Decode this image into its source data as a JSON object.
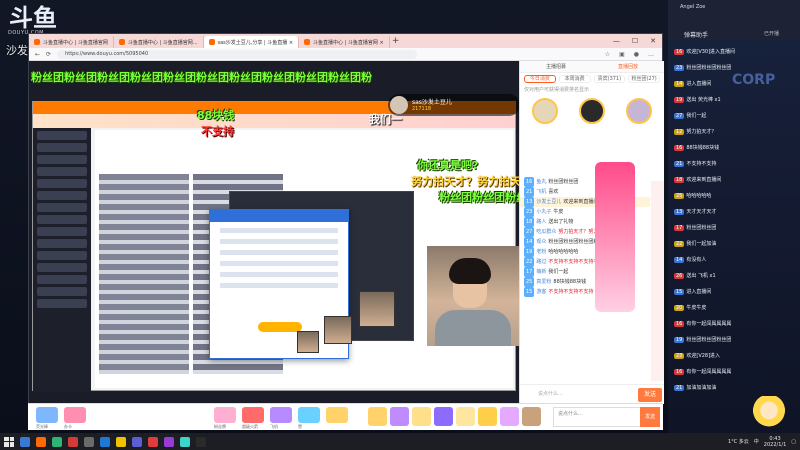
{
  "overlay_left": {
    "logo_text": "斗鱼",
    "logo_sub": "DOUYU.COM",
    "streamer_name": "沙发土豆儿"
  },
  "browser": {
    "tabs": [
      {
        "label": "斗鱼直播中心 | 斗鱼直播官网"
      },
      {
        "label": "斗鱼直播中心 | 斗鱼直播官网..."
      },
      {
        "label": "sas沙发土豆儿,分享 | 斗鱼直播 ×"
      },
      {
        "label": "斗鱼直播中心 | 斗鱼直播官网 ×"
      }
    ],
    "url": "https://www.douyu.com/5095040",
    "controls": {
      "minimize": "—",
      "maximize": "☐",
      "close": "✕"
    }
  },
  "stream": {
    "anchor": {
      "name": "sas沙发土豆儿",
      "hot": "217118"
    },
    "danmu": [
      {
        "text": "粉丝团粉丝团粉丝团粉丝团粉丝团粉丝团粉丝团粉丝团粉丝团粉丝团粉",
        "style": "green"
      },
      {
        "text": "88块钱",
        "style": "green"
      },
      {
        "text": "不支持",
        "style": "red"
      },
      {
        "text": "我们一",
        "style": "white"
      },
      {
        "text": "你还真是吧?",
        "style": "green"
      },
      {
        "text": "努力拍天才？努力拍天才",
        "style": "gold"
      },
      {
        "text": "粉丝团粉丝团粉丝团粉丝团粉丝",
        "style": "green"
      },
      {
        "text": "你",
        "style": "green"
      }
    ],
    "player": {
      "play_icon": "❚❚",
      "refresh_icon": "⟳",
      "volume_fraction": 0.45
    }
  },
  "chat": {
    "tabs": [
      "主播招募",
      "直播回放"
    ],
    "sub_tabs": [
      "今日消费",
      "本周消费",
      "贵宾(371)",
      "粉丝团(27)"
    ],
    "note": "仅对用户可获得消费排名显示",
    "rank_badges": [
      "1",
      "2",
      "3"
    ],
    "messages": [
      {
        "level": "16",
        "nick": "鱼丸",
        "text": "粉丝团粉丝团",
        "style": ""
      },
      {
        "level": "21",
        "nick": "飞机",
        "text": "喜欢",
        "style": ""
      },
      {
        "level": "13",
        "nick": "沙发土豆儿",
        "text": "欢迎来到直播间",
        "style": "highlight"
      },
      {
        "level": "23",
        "nick": "小丸子",
        "text": "牛皮",
        "style": ""
      },
      {
        "level": "18",
        "nick": "路人",
        "text": "送出了礼物",
        "style": ""
      },
      {
        "level": "27",
        "nick": "吃瓜群众",
        "text": "努力拍天才？努力拍天才？",
        "style": "redline"
      },
      {
        "level": "14",
        "nick": "观众",
        "text": "粉丝团粉丝团粉丝团粉丝团",
        "style": ""
      },
      {
        "level": "19",
        "nick": "老粉",
        "text": "哈哈哈哈哈哈",
        "style": ""
      },
      {
        "level": "22",
        "nick": "路过",
        "text": "不支持不支持不支持不支持",
        "style": "redline"
      },
      {
        "level": "17",
        "nick": "萌新",
        "text": "我们一起",
        "style": ""
      },
      {
        "level": "25",
        "nick": "真爱粉",
        "text": "88块钱88块钱",
        "style": ""
      },
      {
        "level": "15",
        "nick": "游客",
        "text": "不支持不支持不支持",
        "style": "redline"
      }
    ],
    "input_placeholder": "说点什么…",
    "send_label": "发送"
  },
  "giftbar": {
    "labels": [
      "荧光棒",
      "办卡",
      "粉丝牌",
      "超级火箭",
      "飞机",
      "赞"
    ],
    "input_placeholder": "说点什么…",
    "send_label": "发送"
  },
  "overlay_right": {
    "user": "Angel Zoe",
    "title": "弹幕助手",
    "status": "已开播",
    "corp": "CORP",
    "lines": [
      {
        "tag": "16",
        "tag_color": "red",
        "text": "欢迎[V30]进入直播间"
      },
      {
        "tag": "23",
        "tag_color": "blue",
        "text": "粉丝团粉丝团粉丝团"
      },
      {
        "tag": "14",
        "tag_color": "yellow",
        "text": "进入直播间"
      },
      {
        "tag": "19",
        "tag_color": "red",
        "text": "送出 荧光棒 x1"
      },
      {
        "tag": "27",
        "tag_color": "blue",
        "text": "我们一起"
      },
      {
        "tag": "12",
        "tag_color": "yellow",
        "text": "努力拍天才？"
      },
      {
        "tag": "16",
        "tag_color": "red",
        "text": "88块钱88块钱"
      },
      {
        "tag": "21",
        "tag_color": "blue",
        "text": "不支持不支持"
      },
      {
        "tag": "18",
        "tag_color": "red",
        "text": "欢迎来到直播间"
      },
      {
        "tag": "25",
        "tag_color": "yellow",
        "text": "哈哈哈哈哈"
      },
      {
        "tag": "13",
        "tag_color": "blue",
        "text": "天才天才天才"
      },
      {
        "tag": "17",
        "tag_color": "red",
        "text": "粉丝团粉丝团"
      },
      {
        "tag": "22",
        "tag_color": "yellow",
        "text": "我们一起加油"
      },
      {
        "tag": "14",
        "tag_color": "blue",
        "text": "有没有人"
      },
      {
        "tag": "26",
        "tag_color": "red",
        "text": "送出 飞机 x1"
      },
      {
        "tag": "15",
        "tag_color": "blue",
        "text": "进入直播间"
      },
      {
        "tag": "20",
        "tag_color": "yellow",
        "text": "牛皮牛皮"
      },
      {
        "tag": "16",
        "tag_color": "red",
        "text": "有你一起闯属属属属"
      },
      {
        "tag": "19",
        "tag_color": "blue",
        "text": "粉丝团粉丝团粉丝团"
      },
      {
        "tag": "23",
        "tag_color": "yellow",
        "text": "欢迎[V28]进入"
      },
      {
        "tag": "16",
        "tag_color": "red",
        "text": "有你一起闯属属属属"
      },
      {
        "tag": "21",
        "tag_color": "blue",
        "text": "加油加油加油"
      }
    ]
  },
  "taskbar": {
    "weather": "1°C 多云",
    "time": "0:43",
    "date": "2022/1/1",
    "lang": "中"
  },
  "colors": {
    "accent": "#ff7a00",
    "danmu_green": "#7bff3c",
    "danmu_red": "#ff3838",
    "danmu_gold": "#ffd23c",
    "tab_bar": "#f6d9d6"
  }
}
